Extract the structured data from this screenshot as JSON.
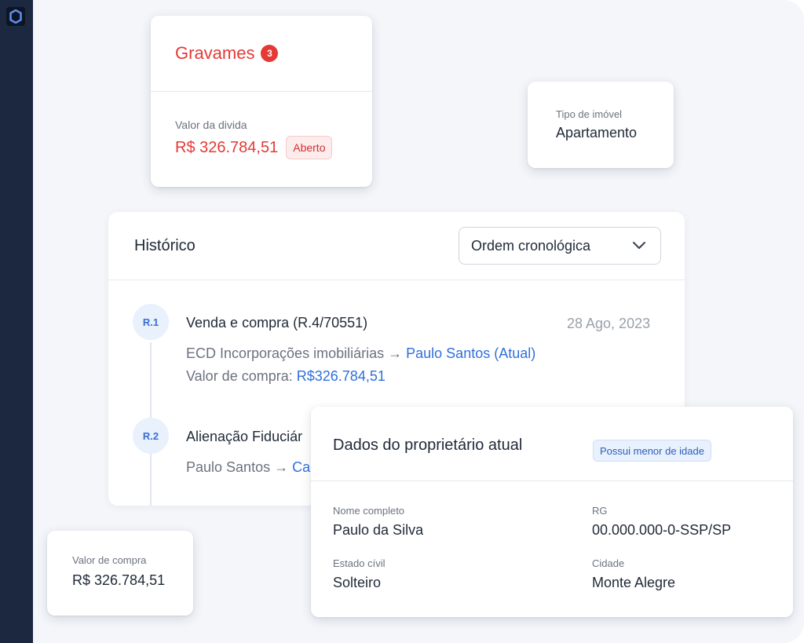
{
  "gravames": {
    "title": "Gravames",
    "count": "3",
    "debt_label": "Valor da divida",
    "debt_value": "R$ 326.784,51",
    "status": "Aberto"
  },
  "property_type": {
    "label": "Tipo de imóvel",
    "value": "Apartamento"
  },
  "history": {
    "title": "Histórico",
    "sort_select": "Ordem cronológica",
    "entries": [
      {
        "badge": "R.1",
        "title": "Venda e compra (R.4/70551)",
        "date": "28 Ago, 2023",
        "from": "ECD Incorporações imobiliárias",
        "arrow": "→",
        "to": "Paulo Santos (Atual)",
        "value_label": "Valor de compra:",
        "value": "R$326.784,51"
      },
      {
        "badge": "R.2",
        "title": "Alienação Fiduciár",
        "from": "Paulo Santos",
        "arrow": "→",
        "to": "Ca"
      }
    ]
  },
  "purchase_value": {
    "label": "Valor de compra",
    "value": "R$ 326.784,51"
  },
  "owner": {
    "title": "Dados do proprietário atual",
    "badge": "Possui menor de idade",
    "fields": {
      "name": {
        "label": "Nome completo",
        "value": "Paulo da Silva"
      },
      "rg": {
        "label": "RG",
        "value": "00.000.000-0-SSP/SP"
      },
      "civil": {
        "label": "Estado cívil",
        "value": "Solteiro"
      },
      "city": {
        "label": "Cidade",
        "value": "Monte Alegre"
      }
    }
  },
  "colors": {
    "sidebar": "#1c2740",
    "danger": "#e53935",
    "link": "#2f6fdc",
    "background": "#f4f6fa"
  },
  "icons": [
    "app-logo-icon",
    "chevron-down-icon",
    "arrow-right-icon"
  ]
}
